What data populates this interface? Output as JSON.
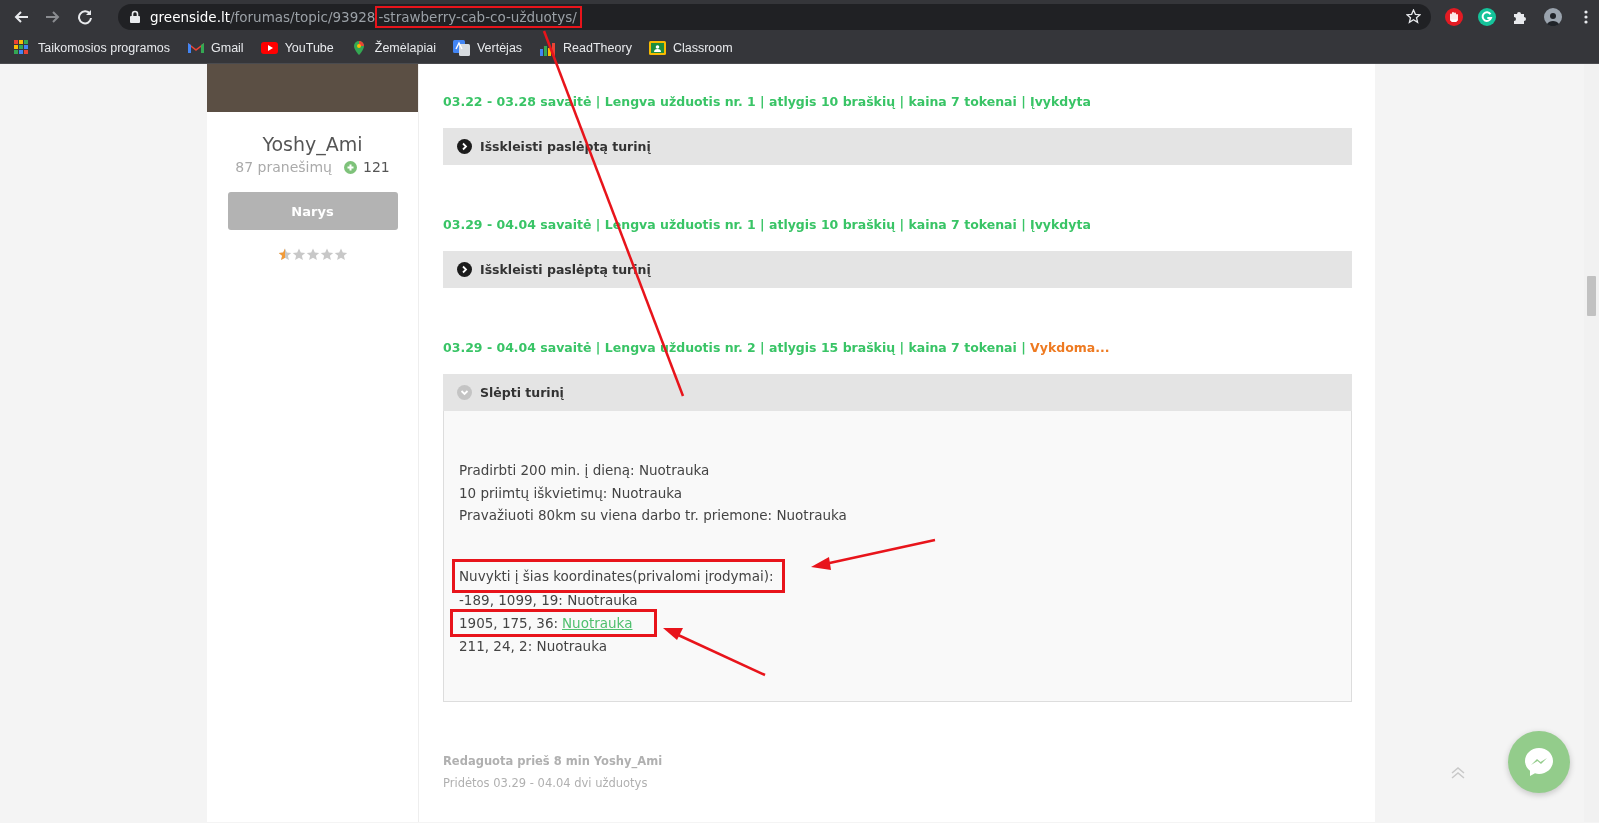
{
  "browser": {
    "url": [
      {
        "text": "greenside.lt",
        "kind": "host",
        "annotated": false
      },
      {
        "text": "/forumas/topic/93928",
        "kind": "path",
        "annotated": false
      },
      {
        "text": "-strawberry-cab-co-užduotys/",
        "kind": "path",
        "annotated": true
      }
    ],
    "bookmarks": [
      {
        "label": "Taikomosios programos",
        "kind": "apps"
      },
      {
        "label": "Gmail",
        "kind": "gmail"
      },
      {
        "label": "YouTube",
        "kind": "youtube"
      },
      {
        "label": "Žemėlapiai",
        "kind": "maps"
      },
      {
        "label": "Vertėjas",
        "kind": "translate"
      },
      {
        "label": "ReadTheory",
        "kind": "readtheory"
      },
      {
        "label": "Classroom",
        "kind": "classroom"
      }
    ]
  },
  "author": {
    "name": "Yoshy_Ami",
    "posts": "87 pranešimų",
    "reputation": "121",
    "rank": "Narys",
    "stars": 0.5
  },
  "tasks": [
    {
      "title": "03.22 - 03.28 savaitė | Lengva užduotis nr. 1 | atlygis 10 braškių | kaina 7 tokenai |",
      "status": {
        "text": "Įvykdyta",
        "kind": "done"
      },
      "spoiler": {
        "label": "Išskleisti paslėptą turinį",
        "expanded": false
      }
    },
    {
      "title": "03.29 - 04.04 savaitė | Lengva užduotis nr. 1 | atlygis 10 braškių | kaina 7 tokenai |",
      "status": {
        "text": "Įvykdyta",
        "kind": "done"
      },
      "spoiler": {
        "label": "Išskleisti paslėptą turinį",
        "expanded": false
      }
    },
    {
      "title": "03.29 - 04.04 savaitė | Lengva užduotis nr. 2 | atlygis 15 braškių | kaina 7 tokenai |",
      "status": {
        "text": "Vykdoma...",
        "kind": "in_progress"
      },
      "spoiler": {
        "label": "Slėpti turinį",
        "expanded": true,
        "groups": [
          [
            {
              "text": "Pradirbti 200 min. į dieną: Nuotrauka",
              "annotated": false
            },
            {
              "text": "10 priimtų iškvietimų: Nuotrauka",
              "annotated": false
            },
            {
              "text": "Pravažiuoti 80km su viena darbo tr. priemone: Nuotrauka",
              "annotated": false
            }
          ],
          [
            {
              "text": "Nuvykti į šias koordinates(privalomi įrodymai):",
              "annotated": true
            },
            {
              "text": "-189, 1099, 19: Nuotrauka",
              "annotated": false
            },
            {
              "text": "1905, 175, 36:",
              "link": "Nuotrauka",
              "annotated": true
            },
            {
              "text": "211, 24, 2: Nuotrauka",
              "annotated": false
            }
          ]
        ]
      }
    }
  ],
  "footer": {
    "edited": "Redaguota prieš 8 min Yoshy_Ami",
    "note": "Pridėtos 03.29 - 04.04 dvi užduotys"
  }
}
